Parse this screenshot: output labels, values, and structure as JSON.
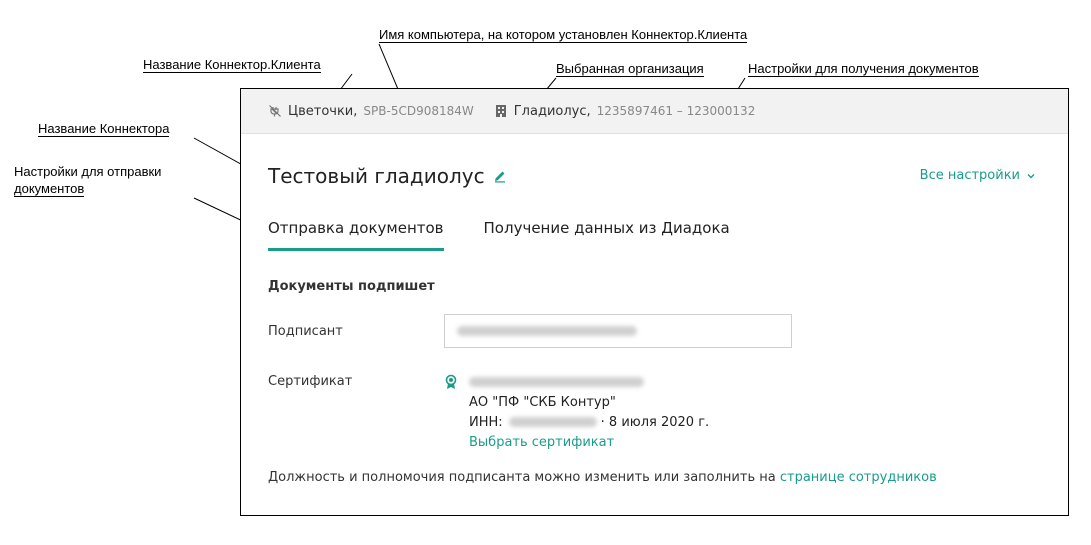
{
  "callouts": {
    "computer_name": "Имя компьютера, на котором установлен Коннектор.Клиента",
    "client_name": "Название Коннектор.Клиента",
    "selected_org": "Выбранная организация",
    "receive_settings": "Настройки для получения документов",
    "connector_name": "Название Коннектора",
    "send_settings_line1": "Настройки для отправки",
    "send_settings_line2": "документов"
  },
  "topbar": {
    "client_icon": "plug-off-icon",
    "client_name": "Цветочки,",
    "computer": "SPB-5CD908184W",
    "org_icon": "building-icon",
    "org_name": "Гладиолус,",
    "org_codes": "1235897461 – 123000132"
  },
  "header": {
    "title": "Тестовый гладиолус",
    "edit_icon": "pencil-icon",
    "settings_label": "Все настройки",
    "settings_icon": "chevron-down-icon"
  },
  "tabs": [
    {
      "label": "Отправка документов",
      "active": true
    },
    {
      "label": "Получение данных из Диадока",
      "active": false
    }
  ],
  "form": {
    "section_title": "Документы подпишет",
    "signer_label": "Подписант",
    "certificate_label": "Сертификат",
    "cert_org": "АО \"ПФ \"СКБ Контур\"",
    "cert_inn_prefix": "ИНН:",
    "cert_date": "· 8 июля 2020 г.",
    "choose_cert": "Выбрать сертификат",
    "cert_icon": "certificate-medal-icon",
    "note_text": "Должность и полномочия подписанта можно изменить или заполнить на ",
    "note_link": "странице сотрудников"
  },
  "colors": {
    "accent": "#1a9c8a",
    "topbar_bg": "#f2f2f2"
  }
}
